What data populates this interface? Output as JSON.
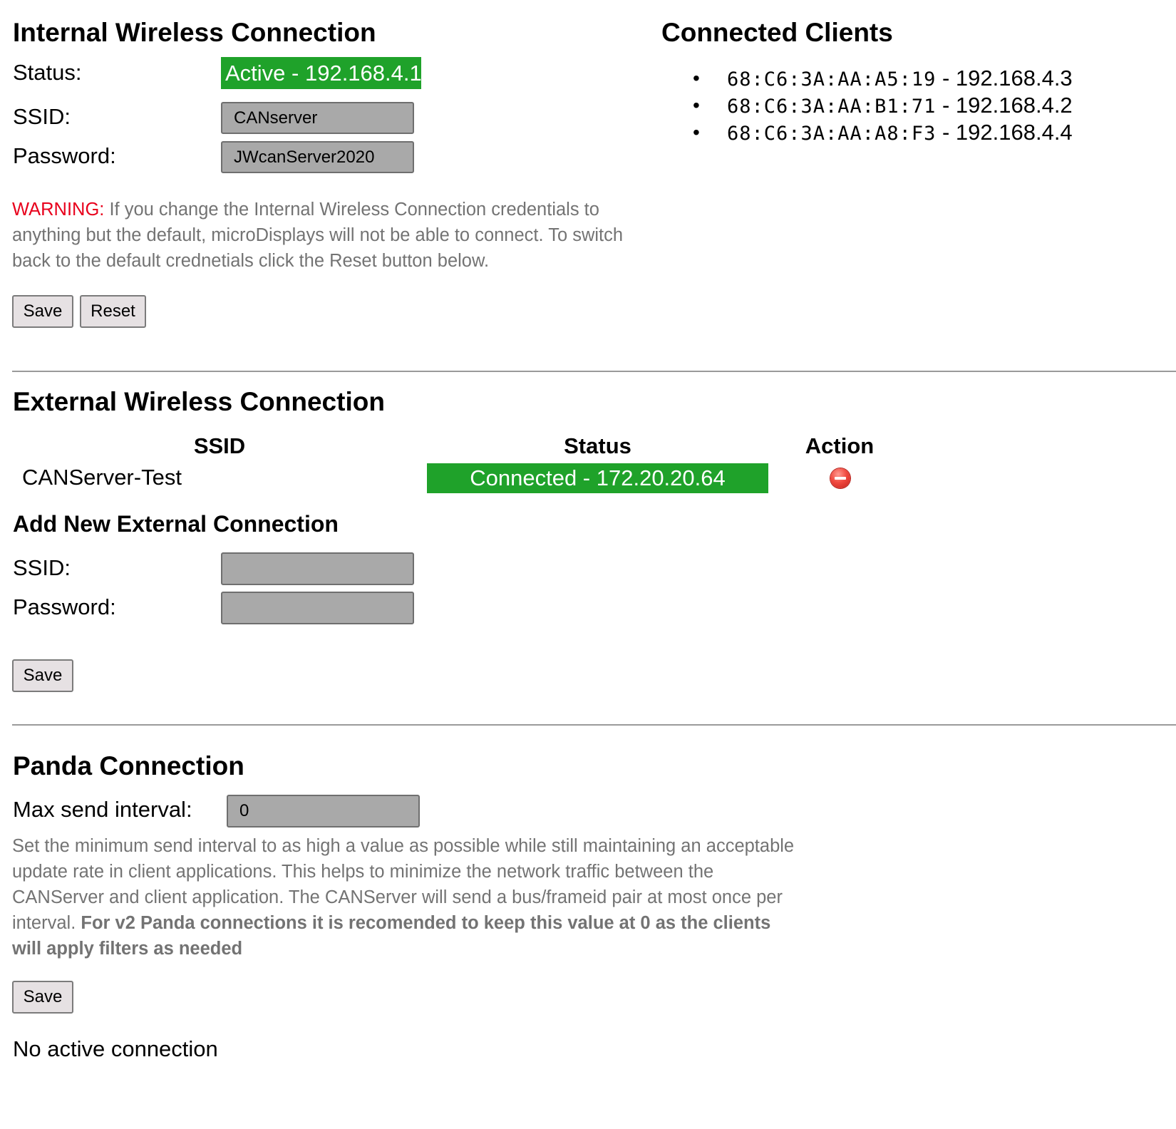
{
  "internal": {
    "title": "Internal Wireless Connection",
    "status_label": "Status:",
    "status_value": "Active - 192.168.4.1",
    "ssid_label": "SSID:",
    "ssid_value": "CANserver",
    "password_label": "Password:",
    "password_value": "JWcanServer2020",
    "warning_prefix": "WARNING:",
    "warning_text": " If you change the Internal Wireless Connection credentials to anything but the default, microDisplays will not be able to connect. To switch back to the default crednetials click the Reset button below.",
    "save_label": "Save",
    "reset_label": "Reset"
  },
  "clients": {
    "title": "Connected Clients",
    "items": [
      {
        "mac": "68:C6:3A:AA:A5:19",
        "ip": "192.168.4.3"
      },
      {
        "mac": "68:C6:3A:AA:B1:71",
        "ip": "192.168.4.2"
      },
      {
        "mac": "68:C6:3A:AA:A8:F3",
        "ip": "192.168.4.4"
      }
    ],
    "separator": " - "
  },
  "external": {
    "title": "External Wireless Connection",
    "headers": {
      "ssid": "SSID",
      "status": "Status",
      "action": "Action"
    },
    "rows": [
      {
        "ssid": "CANServer-Test",
        "status": "Connected - 172.20.20.64",
        "action_icon": "remove-icon"
      }
    ],
    "add_title": "Add New External Connection",
    "ssid_label": "SSID:",
    "ssid_value": "",
    "password_label": "Password:",
    "password_value": "",
    "save_label": "Save"
  },
  "panda": {
    "title": "Panda Connection",
    "interval_label": "Max send interval:",
    "interval_value": "0",
    "note_text": "Set the minimum send interval to as high a value as possible while still maintaining an acceptable update rate in client applications. This helps to minimize the network traffic between the CANServer and client application. The CANServer will send a bus/frameid pair at most once per interval. ",
    "note_bold": "For v2 Panda connections it is recomended to keep this value at 0 as the clients will apply filters as needed",
    "save_label": "Save",
    "connection_status": "No active connection"
  },
  "colors": {
    "status_green": "#1fa22a",
    "warning_red": "#e8001c",
    "field_gray": "#a9a9a9",
    "note_gray": "#737373"
  }
}
